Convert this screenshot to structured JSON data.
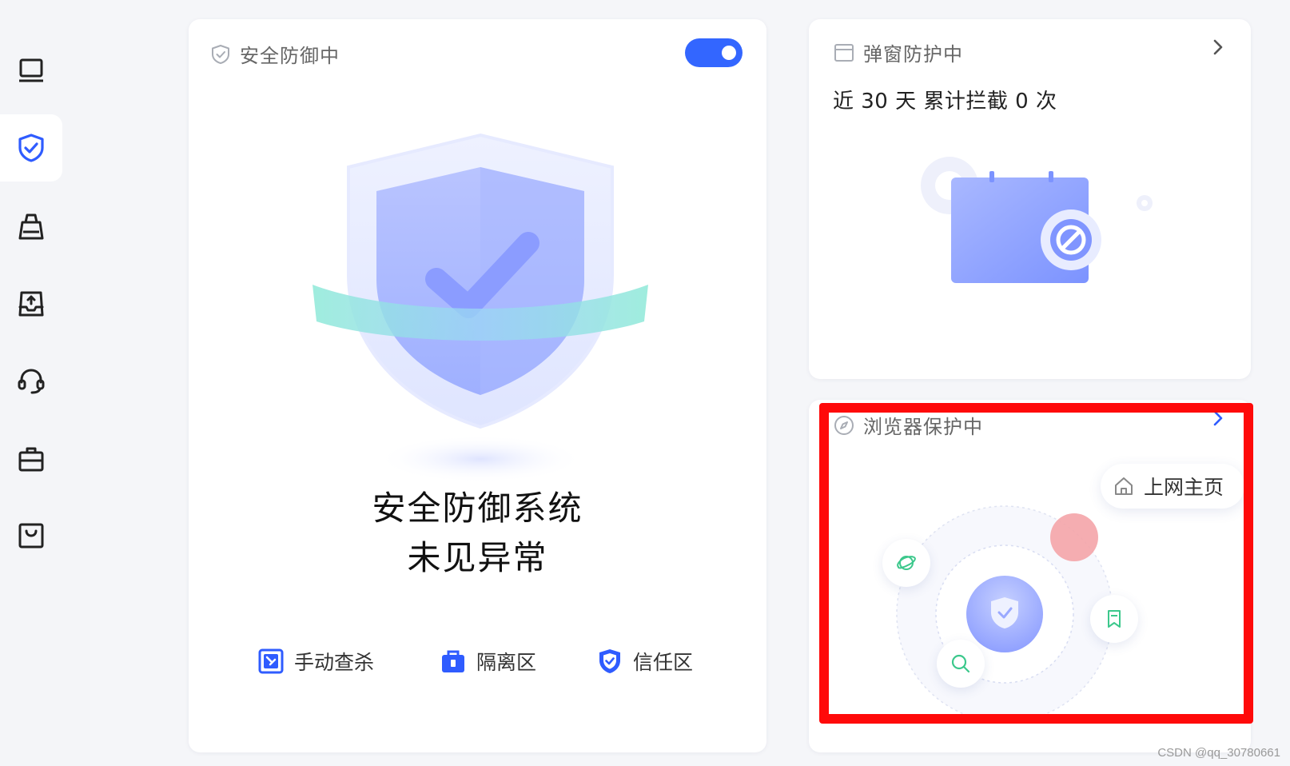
{
  "sidebar": {
    "items": [
      {
        "icon": "monitor-icon"
      },
      {
        "icon": "shield-check-icon",
        "active": true
      },
      {
        "icon": "broom-icon"
      },
      {
        "icon": "inbox-upload-icon"
      },
      {
        "icon": "headset-icon"
      },
      {
        "icon": "toolbox-icon"
      },
      {
        "icon": "shopping-bag-icon"
      }
    ]
  },
  "defense_card": {
    "title": "安全防御中",
    "toggle_on": true,
    "status_line1": "安全防御系统",
    "status_line2": "未见异常",
    "actions": [
      {
        "label": "手动查杀",
        "icon": "manual-scan-icon"
      },
      {
        "label": "隔离区",
        "icon": "quarantine-icon"
      },
      {
        "label": "信任区",
        "icon": "trust-shield-icon"
      }
    ]
  },
  "popup_card": {
    "title": "弹窗防护中",
    "stat": "近 30 天 累计拦截 0 次"
  },
  "browser_card": {
    "title": "浏览器保护中",
    "homepage_label": "上网主页"
  },
  "colors": {
    "accent": "#3366ff",
    "highlight": "#ff0a0a",
    "green": "#3cc88c"
  },
  "watermark": "CSDN @qq_30780661"
}
